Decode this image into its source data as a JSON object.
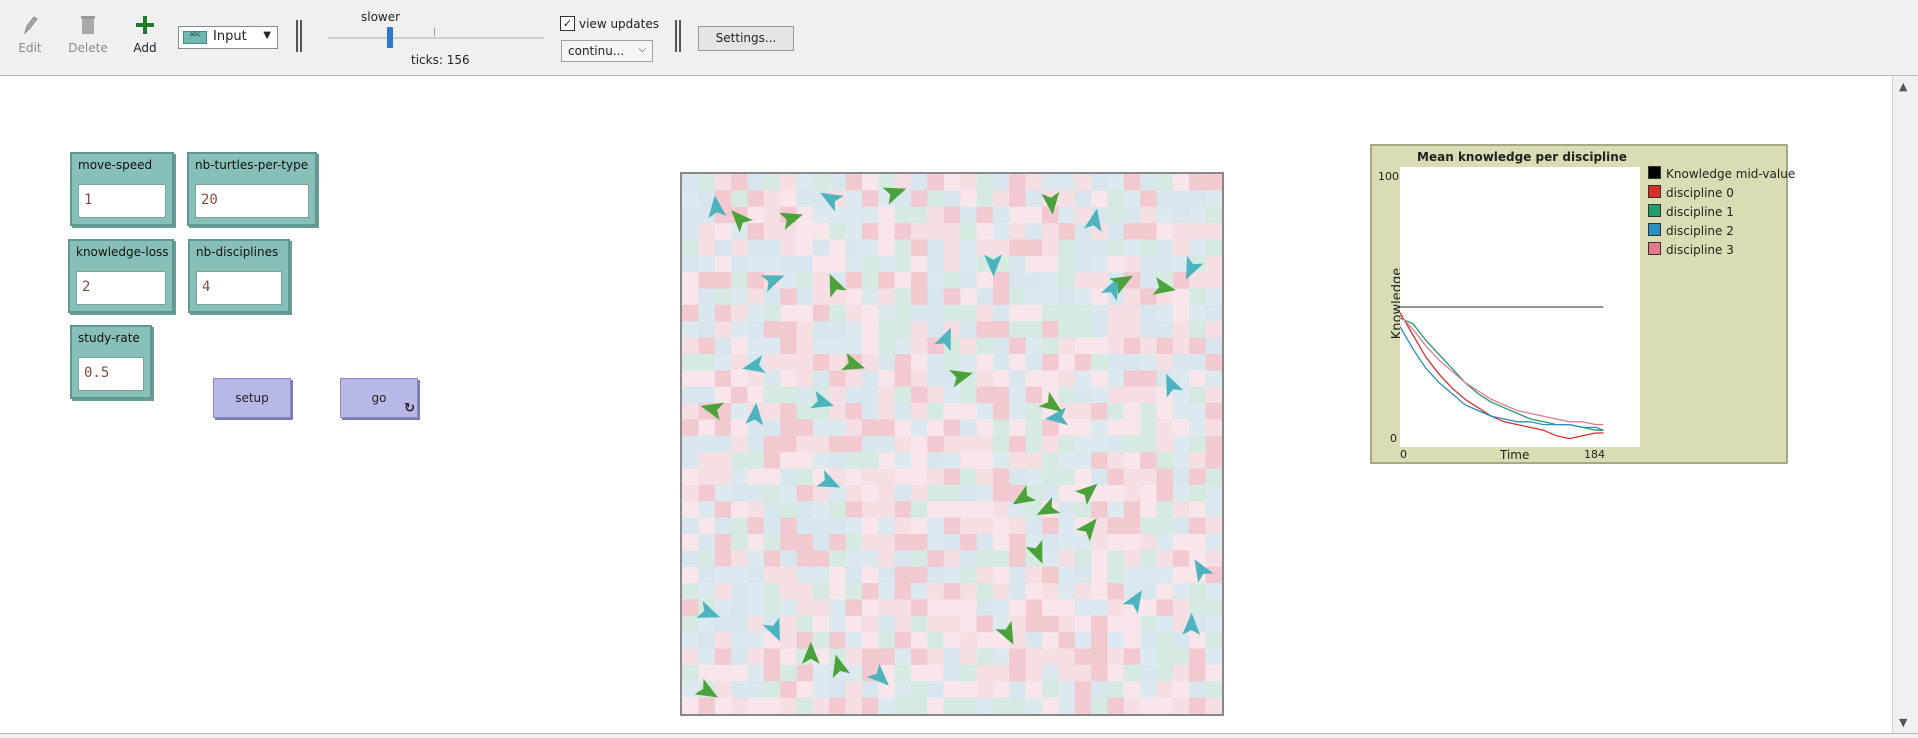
{
  "toolbar": {
    "edit_label": "Edit",
    "delete_label": "Delete",
    "add_label": "Add",
    "widget_select": "Input",
    "speed_label": "slower",
    "ticks_text": "ticks: 156",
    "view_updates_label": "view updates",
    "view_updates_checked": true,
    "update_mode": "continu...",
    "settings_label": "Settings..."
  },
  "inputs": [
    {
      "name": "move-speed",
      "value": "1"
    },
    {
      "name": "nb-turtles-per-type",
      "value": "20"
    },
    {
      "name": "knowledge-loss",
      "value": "2"
    },
    {
      "name": "nb-disciplines",
      "value": "4"
    },
    {
      "name": "study-rate",
      "value": "0.5"
    }
  ],
  "buttons": {
    "setup_label": "setup",
    "go_label": "go"
  },
  "plot": {
    "title": "Mean knowledge per discipline",
    "y_max": "100",
    "y_min": "0",
    "y_label": "Knowledge",
    "x_min": "0",
    "x_label": "Time",
    "x_max": "184",
    "legend": [
      {
        "label": "Knowledge mid-value",
        "color": "#000000"
      },
      {
        "label": "discipline 0",
        "color": "#d7302a"
      },
      {
        "label": "discipline 1",
        "color": "#1e9e6a"
      },
      {
        "label": "discipline 2",
        "color": "#2a8fbf"
      },
      {
        "label": "discipline 3",
        "color": "#e57a8c"
      }
    ]
  },
  "chart_data": {
    "type": "line",
    "title": "Mean knowledge per discipline",
    "xlabel": "Time",
    "ylabel": "Knowledge",
    "xlim": [
      0,
      184
    ],
    "ylim": [
      0,
      100
    ],
    "x": [
      0,
      10,
      20,
      30,
      40,
      50,
      60,
      70,
      80,
      90,
      100,
      110,
      120,
      130,
      140,
      150,
      156
    ],
    "series": [
      {
        "name": "Knowledge mid-value",
        "values": [
          50,
          50,
          50,
          50,
          50,
          50,
          50,
          50,
          50,
          50,
          50,
          50,
          50,
          50,
          50,
          50,
          50
        ]
      },
      {
        "name": "discipline 0",
        "values": [
          48,
          40,
          32,
          26,
          21,
          17,
          14,
          11,
          9,
          8,
          7,
          6,
          4,
          3,
          4,
          5,
          5
        ]
      },
      {
        "name": "discipline 1",
        "values": [
          46,
          44,
          38,
          33,
          28,
          23,
          19,
          16,
          14,
          12,
          10,
          9,
          8,
          8,
          7,
          6,
          6
        ]
      },
      {
        "name": "discipline 2",
        "values": [
          43,
          35,
          28,
          23,
          19,
          15,
          13,
          11,
          10,
          9,
          9,
          8,
          8,
          8,
          7,
          7,
          6
        ]
      },
      {
        "name": "discipline 3",
        "values": [
          47,
          42,
          36,
          31,
          27,
          23,
          20,
          17,
          15,
          13,
          12,
          11,
          10,
          9,
          9,
          8,
          8
        ]
      }
    ]
  }
}
